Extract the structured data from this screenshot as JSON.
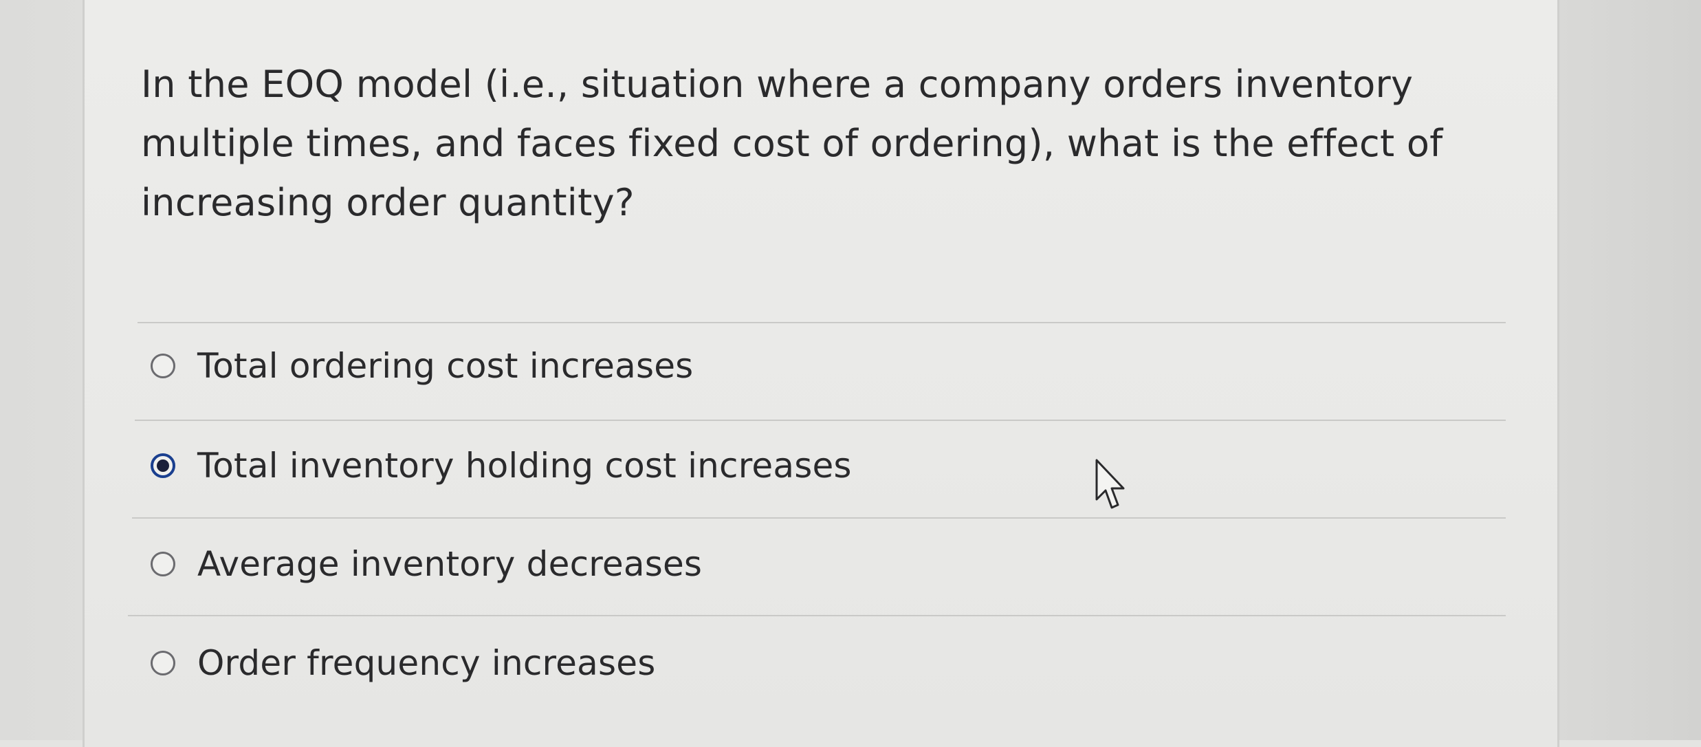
{
  "question": {
    "text": "In the EOQ model (i.e., situation where a company orders inventory multiple times, and faces fixed cost of ordering), what is the effect of increasing order quantity?"
  },
  "answers": [
    {
      "label": "Total ordering cost increases",
      "selected": false
    },
    {
      "label": "Total inventory holding cost increases",
      "selected": true
    },
    {
      "label": "Average inventory decreases",
      "selected": false
    },
    {
      "label": "Order frequency increases",
      "selected": false
    }
  ],
  "icons": {
    "radio_unselected": "radio-empty-icon",
    "radio_selected": "radio-filled-icon",
    "cursor": "mouse-pointer-icon"
  },
  "colors": {
    "text": "#2a2a2c",
    "selected_radio": "#1a3f8f",
    "background": "#e9e9e7"
  }
}
